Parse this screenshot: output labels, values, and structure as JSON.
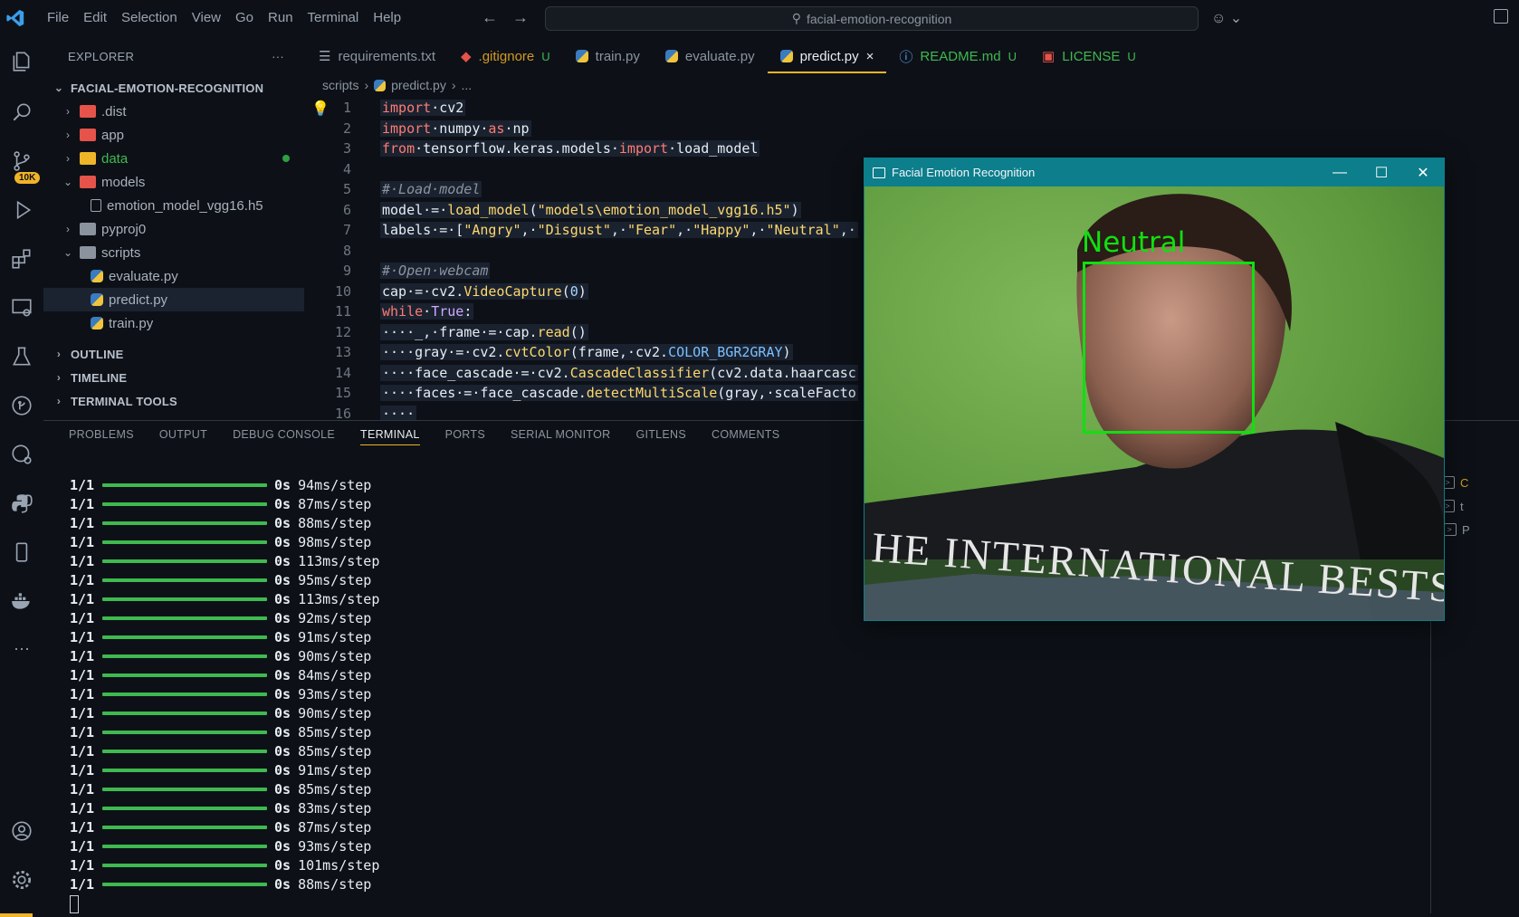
{
  "titlebar": {
    "menu": [
      "File",
      "Edit",
      "Selection",
      "View",
      "Go",
      "Run",
      "Terminal",
      "Help"
    ],
    "search_text": "facial-emotion-recognition"
  },
  "activity": {
    "scm_badge": "10K"
  },
  "sidebar": {
    "title": "EXPLORER",
    "more": "···",
    "root": "FACIAL-EMOTION-RECOGNITION",
    "items": [
      {
        "label": ".dist",
        "kind": "folder",
        "color": "#e5534b",
        "expanded": false
      },
      {
        "label": "app",
        "kind": "folder",
        "color": "#e5534b",
        "expanded": false
      },
      {
        "label": "data",
        "kind": "folder",
        "color": "#f0b429",
        "expanded": false,
        "modified": true
      },
      {
        "label": "models",
        "kind": "folder",
        "color": "#e5534b",
        "expanded": true
      },
      {
        "label": "emotion_model_vgg16.h5",
        "kind": "file"
      },
      {
        "label": "pyproj0",
        "kind": "folder",
        "color": "#8b949e",
        "expanded": false
      },
      {
        "label": "scripts",
        "kind": "folder",
        "color": "#8b949e",
        "expanded": true
      },
      {
        "label": "evaluate.py",
        "kind": "py"
      },
      {
        "label": "predict.py",
        "kind": "py",
        "selected": true
      },
      {
        "label": "train.py",
        "kind": "py"
      }
    ],
    "sections": [
      "OUTLINE",
      "TIMELINE",
      "TERMINAL TOOLS"
    ]
  },
  "tabs": [
    {
      "label": "requirements.txt",
      "status": "",
      "icon": "text-file-icon"
    },
    {
      "label": ".gitignore",
      "status": "U",
      "icon": "git-icon"
    },
    {
      "label": "train.py",
      "status": "",
      "icon": "python-icon"
    },
    {
      "label": "evaluate.py",
      "status": "",
      "icon": "python-icon"
    },
    {
      "label": "predict.py",
      "status": "×",
      "icon": "python-icon",
      "active": true
    },
    {
      "label": "README.md",
      "status": "U",
      "icon": "info-icon"
    },
    {
      "label": "LICENSE",
      "status": "U",
      "icon": "license-icon"
    }
  ],
  "breadcrumb": {
    "folder": "scripts",
    "file": "predict.py",
    "more": "..."
  },
  "editor": {
    "line_numbers": [
      "1",
      "2",
      "3",
      "4",
      "5",
      "6",
      "7",
      "8",
      "9",
      "10",
      "11",
      "12",
      "13",
      "14",
      "15",
      "16"
    ]
  },
  "panel": {
    "tabs": [
      "PROBLEMS",
      "OUTPUT",
      "DEBUG CONSOLE",
      "TERMINAL",
      "PORTS",
      "SERIAL MONITOR",
      "GITLENS",
      "COMMENTS"
    ],
    "active_tab": "TERMINAL",
    "terminal_lines": [
      {
        "frac": "1/1",
        "time": "0s",
        "step": "94ms/step"
      },
      {
        "frac": "1/1",
        "time": "0s",
        "step": "87ms/step"
      },
      {
        "frac": "1/1",
        "time": "0s",
        "step": "88ms/step"
      },
      {
        "frac": "1/1",
        "time": "0s",
        "step": "98ms/step"
      },
      {
        "frac": "1/1",
        "time": "0s",
        "step": "113ms/step"
      },
      {
        "frac": "1/1",
        "time": "0s",
        "step": "95ms/step"
      },
      {
        "frac": "1/1",
        "time": "0s",
        "step": "113ms/step"
      },
      {
        "frac": "1/1",
        "time": "0s",
        "step": "92ms/step"
      },
      {
        "frac": "1/1",
        "time": "0s",
        "step": "91ms/step"
      },
      {
        "frac": "1/1",
        "time": "0s",
        "step": "90ms/step"
      },
      {
        "frac": "1/1",
        "time": "0s",
        "step": "84ms/step"
      },
      {
        "frac": "1/1",
        "time": "0s",
        "step": "93ms/step"
      },
      {
        "frac": "1/1",
        "time": "0s",
        "step": "90ms/step"
      },
      {
        "frac": "1/1",
        "time": "0s",
        "step": "85ms/step"
      },
      {
        "frac": "1/1",
        "time": "0s",
        "step": "85ms/step"
      },
      {
        "frac": "1/1",
        "time": "0s",
        "step": "91ms/step"
      },
      {
        "frac": "1/1",
        "time": "0s",
        "step": "85ms/step"
      },
      {
        "frac": "1/1",
        "time": "0s",
        "step": "83ms/step"
      },
      {
        "frac": "1/1",
        "time": "0s",
        "step": "87ms/step"
      },
      {
        "frac": "1/1",
        "time": "0s",
        "step": "93ms/step"
      },
      {
        "frac": "1/1",
        "time": "0s",
        "step": "101ms/step"
      },
      {
        "frac": "1/1",
        "time": "0s",
        "step": "88ms/step"
      }
    ],
    "progress_fill": 1.0,
    "side_items": [
      "C",
      "t",
      "P"
    ]
  },
  "window": {
    "title": "Facial Emotion Recognition",
    "detected_label": "Neutral",
    "shirt_text": "HE INTERNATIONAL BESTS",
    "box_color": "#10e010"
  },
  "colors": {
    "accent": "#f0b429",
    "git_untracked": "#3fb950",
    "git_modified": "#d29922"
  }
}
